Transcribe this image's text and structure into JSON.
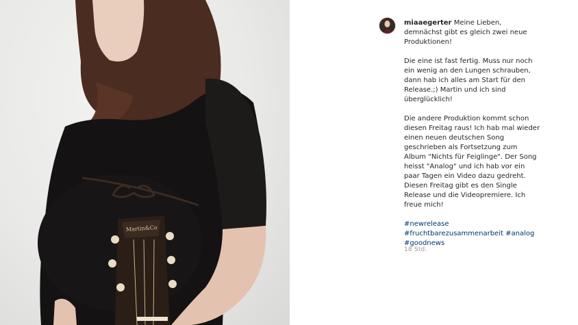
{
  "post": {
    "username": "miaaegerter",
    "intro": "Meine Lieben, demnächst gibt es gleich zwei neue Produktionen!",
    "paragraph_2": "Die eine ist fast fertig. Muss nur noch ein wenig an den Lungen schrauben, dann hab ich alles am Start für den Release.;) Martin und ich sind überglücklich!",
    "paragraph_3": "Die andere Produktion kommt schon diesen Freitag raus! Ich hab mal wieder einen neuen deutschen Song geschrieben als Fortsetzung zum Album \"Nichts für Feiglinge\". Der Song heisst \"Analog\" und ich hab vor ein paar Tagen ein Video dazu gedreht. Diesen Freitag gibt es den Single Release und die Videopremiere. Ich freue mich!",
    "hashtags": [
      "#newrelease",
      "#fruchtbarezusammenarbeit",
      "#analog",
      "#goodnews"
    ],
    "timestamp": "18 Std.",
    "guitar_brand": "Martin&Co"
  },
  "colors": {
    "link": "#003569",
    "text": "#262626",
    "muted": "#999999"
  }
}
